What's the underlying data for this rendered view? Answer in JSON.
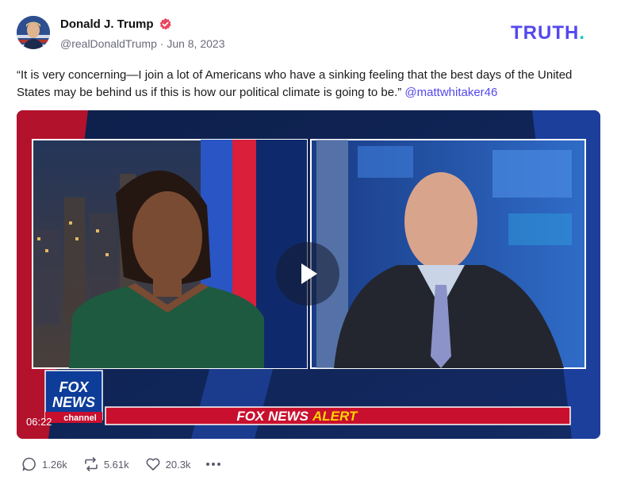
{
  "author": {
    "display_name": "Donald J. Trump",
    "handle": "@realDonaldTrump",
    "separator": "·",
    "date": "Jun 8, 2023"
  },
  "brand": {
    "logo_text": "TRUTH",
    "logo_dot": "."
  },
  "post": {
    "text": "“It is very concerning—I join a lot of Americans who have a sinking feeling that the best days of the United States may be behind us if this is how our political climate is going to be.”",
    "mention": "@mattwhitaker46"
  },
  "video": {
    "duration": "06:22",
    "logo_line1": "FOX",
    "logo_line2": "NEWS",
    "logo_line3": "channel",
    "banner_prefix": "FOX NEWS",
    "banner_alert": "ALERT"
  },
  "actions": {
    "replies": "1.26k",
    "retruths": "5.61k",
    "likes": "20.3k"
  },
  "colors": {
    "brand_purple": "#5448ee",
    "brand_teal": "#1fc7b1",
    "verified_badge": "#e8465f",
    "fox_red": "#c8102e",
    "alert_yellow": "#ffd400"
  }
}
